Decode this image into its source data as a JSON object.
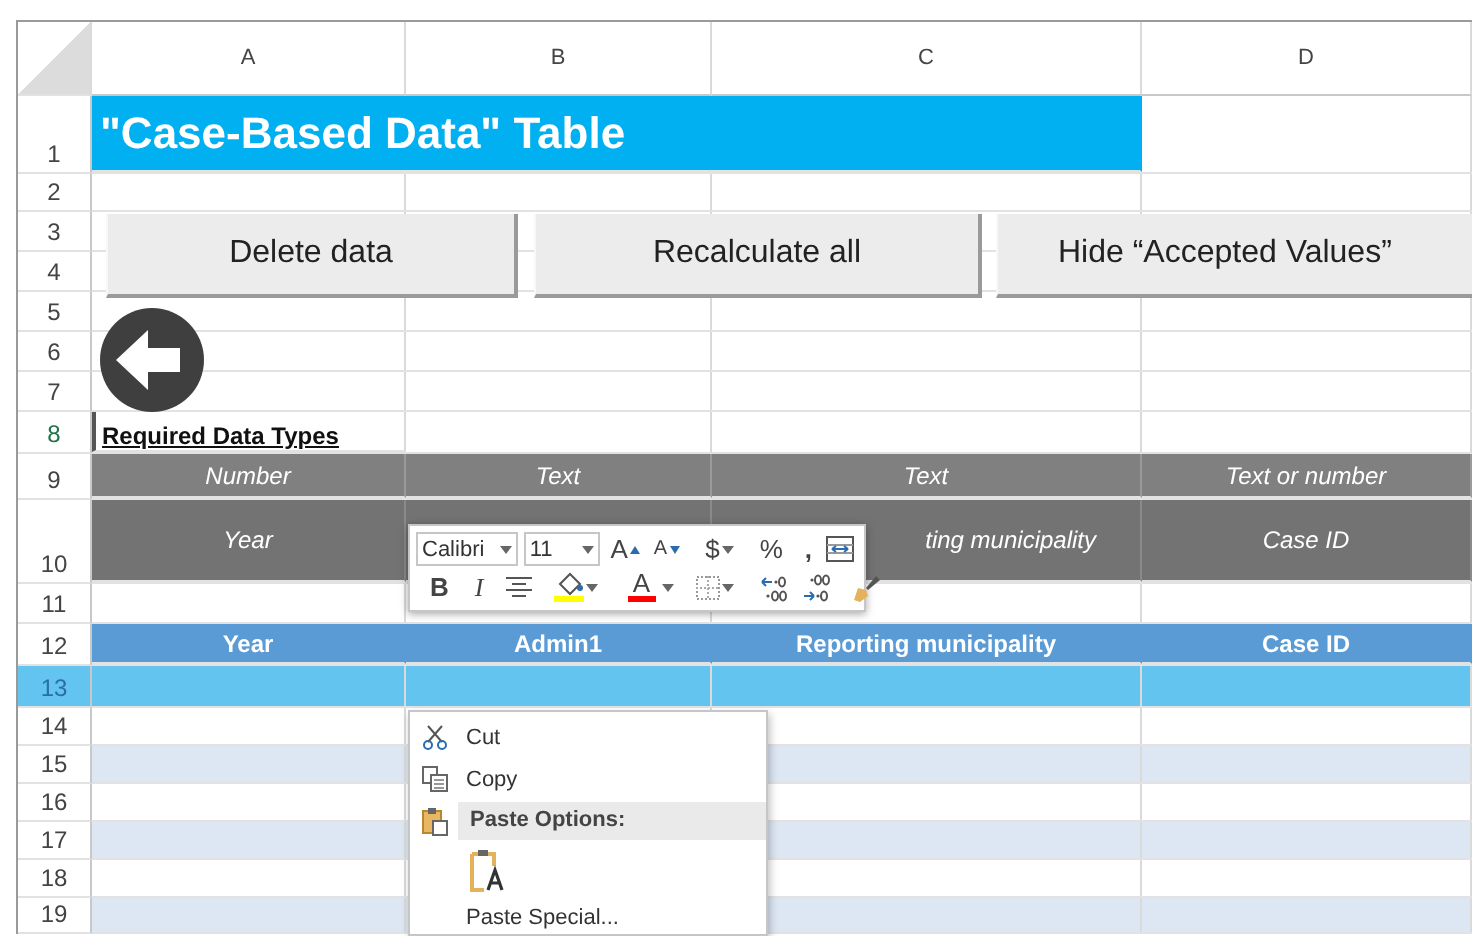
{
  "columns": [
    {
      "label": "A"
    },
    {
      "label": "B"
    },
    {
      "label": "C"
    },
    {
      "label": "D"
    }
  ],
  "rows": [
    {
      "number": "1",
      "kind": "title",
      "text": "\"Case-Based Data\" Table",
      "selected": false,
      "active": false
    },
    {
      "number": "2",
      "kind": "blank",
      "selected": false,
      "active": false
    },
    {
      "number": "3",
      "kind": "blank",
      "selected": false,
      "active": false
    },
    {
      "number": "4",
      "kind": "blank",
      "selected": false,
      "active": false
    },
    {
      "number": "5",
      "kind": "blank",
      "selected": false,
      "active": false
    },
    {
      "number": "6",
      "kind": "blank",
      "selected": false,
      "active": false
    },
    {
      "number": "7",
      "kind": "blank",
      "selected": false,
      "active": false
    },
    {
      "number": "8",
      "kind": "label",
      "text": "Required Data Types",
      "selected": false,
      "active": true
    },
    {
      "number": "9",
      "kind": "types",
      "cells": [
        "Number",
        "Text",
        "Text",
        "Text or number"
      ],
      "selected": false,
      "active": false
    },
    {
      "number": "10",
      "kind": "names",
      "cells": [
        "Year",
        null,
        "ting municipality",
        "Case ID"
      ],
      "selected": false,
      "active": false
    },
    {
      "number": "11",
      "kind": "blank",
      "selected": false,
      "active": false
    },
    {
      "number": "12",
      "kind": "header",
      "cells": [
        "Year",
        "Admin1",
        "Reporting municipality",
        "Case ID"
      ],
      "selected": false,
      "active": false
    },
    {
      "number": "13",
      "kind": "blank",
      "selected": true,
      "active": false
    },
    {
      "number": "14",
      "kind": "band",
      "striped": false,
      "selected": false,
      "active": false
    },
    {
      "number": "15",
      "kind": "band",
      "striped": true,
      "selected": false,
      "active": false
    },
    {
      "number": "16",
      "kind": "band",
      "striped": false,
      "selected": false,
      "active": false
    },
    {
      "number": "17",
      "kind": "band",
      "striped": true,
      "selected": false,
      "active": false
    },
    {
      "number": "18",
      "kind": "band",
      "striped": false,
      "selected": false,
      "active": false
    },
    {
      "number": "19",
      "kind": "band",
      "striped": true,
      "selected": false,
      "active": false
    }
  ],
  "buttons": [
    {
      "label": "Delete data"
    },
    {
      "label": "Recalculate all"
    },
    {
      "label": "Hide “Accepted Values”"
    }
  ],
  "mini_toolbar": {
    "font": "Calibri",
    "size": "11",
    "row_1": [
      {
        "kind": "grow",
        "label": "A"
      },
      {
        "kind": "shrink",
        "label": "A"
      },
      {
        "kind": "currency",
        "label": "$"
      },
      {
        "kind": "percent",
        "label": "%"
      },
      {
        "kind": "comma",
        "label": ","
      },
      {
        "kind": "format"
      }
    ],
    "row_2": [
      {
        "kind": "bold",
        "label": "B"
      },
      {
        "kind": "italic",
        "label": "I"
      },
      {
        "kind": "align"
      },
      {
        "kind": "fill"
      },
      {
        "kind": "font-color",
        "label": "A"
      },
      {
        "kind": "borders"
      },
      {
        "kind": "increase-decimal"
      },
      {
        "kind": "decrease-decimal"
      },
      {
        "kind": "painter"
      }
    ]
  },
  "context_menu": [
    {
      "kind": "cut",
      "label": "Cut"
    },
    {
      "kind": "copy",
      "label": "Copy"
    },
    {
      "kind": "heading",
      "label": "Paste Options:"
    },
    {
      "kind": "paste-option"
    },
    {
      "kind": "command",
      "label": "Paste Special..."
    }
  ]
}
